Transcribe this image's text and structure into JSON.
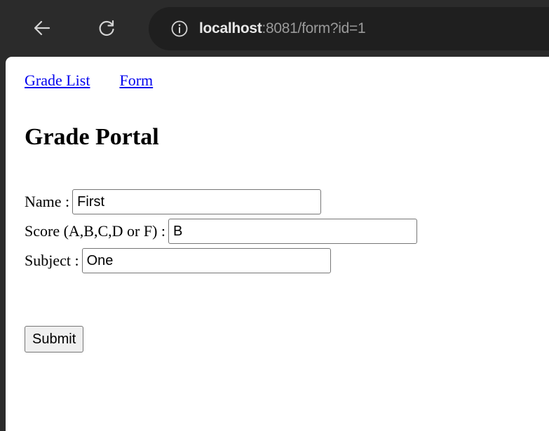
{
  "browser": {
    "url_host": "localhost",
    "url_rest": ":8081/form?id=1",
    "icons": {
      "back": "back-arrow-icon",
      "reload": "reload-icon",
      "info": "info-icon"
    }
  },
  "nav": {
    "links": [
      "Grade List",
      "Form"
    ]
  },
  "page": {
    "title": "Grade Portal"
  },
  "form": {
    "name_label": "Name :",
    "name_value": "First",
    "score_label": "Score (A,B,C,D or F) :",
    "score_value": "B",
    "subject_label": "Subject :",
    "subject_value": "One",
    "submit_label": "Submit"
  },
  "colors": {
    "toolbar_bg": "#2b2b2b",
    "omnibox_bg": "#1f1f1f",
    "link": "#0000ee"
  }
}
